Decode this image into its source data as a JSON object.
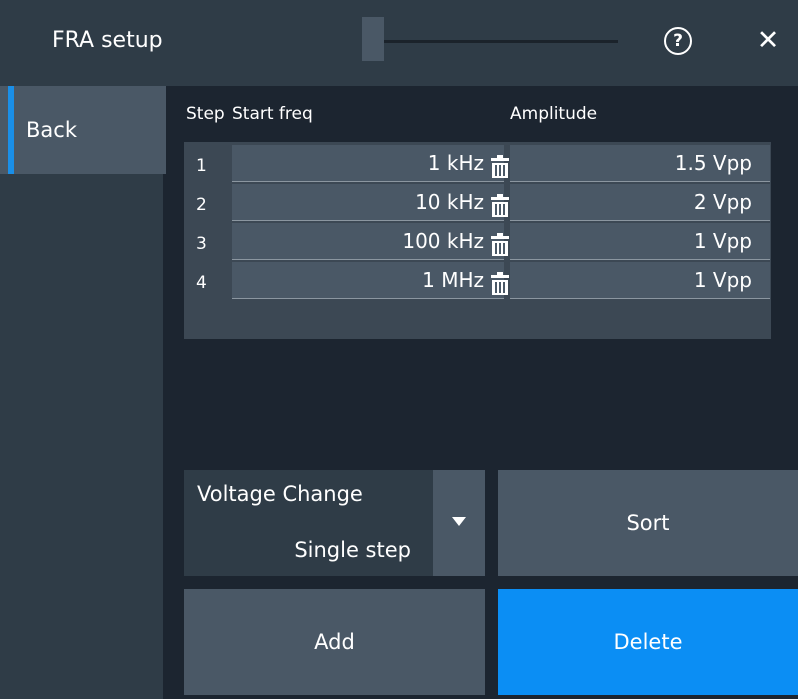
{
  "dialog": {
    "title": "FRA setup"
  },
  "sidebar": {
    "back_label": "Back"
  },
  "table": {
    "headers": {
      "step": "Step",
      "start_freq": "Start freq",
      "amplitude": "Amplitude"
    },
    "rows": [
      {
        "step": "1",
        "start_freq": "1 kHz",
        "amplitude": "1.5 Vpp"
      },
      {
        "step": "2",
        "start_freq": "10 kHz",
        "amplitude": "2 Vpp"
      },
      {
        "step": "3",
        "start_freq": "100 kHz",
        "amplitude": "1 Vpp"
      },
      {
        "step": "4",
        "start_freq": "1 MHz",
        "amplitude": "1 Vpp"
      }
    ]
  },
  "voltage_change": {
    "label": "Voltage Change",
    "value": "Single step"
  },
  "buttons": {
    "sort": "Sort",
    "add": "Add",
    "delete": "Delete"
  },
  "icons": {
    "help": "?",
    "close": "✕"
  },
  "colors": {
    "accent": "#1a8fe8",
    "delete_button": "#0b8ef4",
    "background": "#1c2530",
    "panel": "#2f3c47",
    "cell": "#4a5866"
  }
}
